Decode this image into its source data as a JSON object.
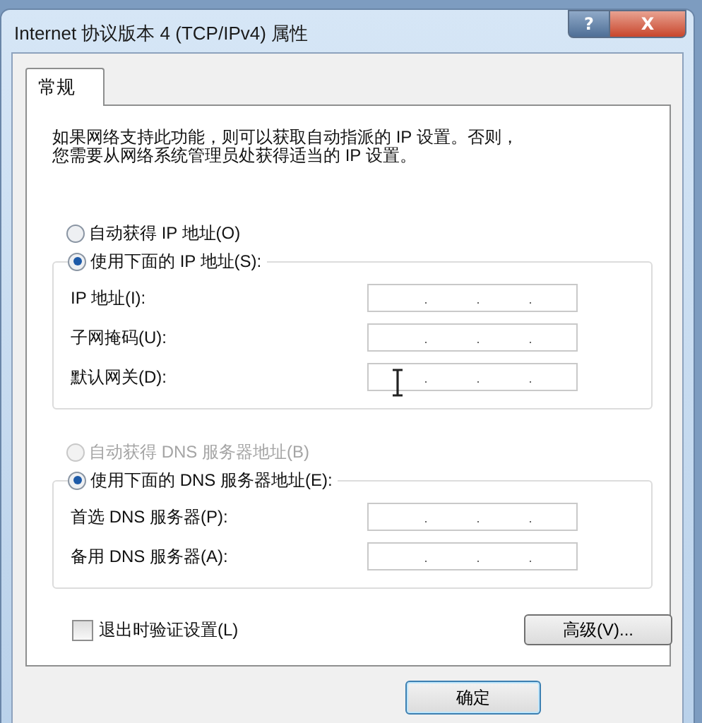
{
  "window": {
    "title": "Internet 协议版本 4 (TCP/IPv4) 属性",
    "caption_buttons": [
      {
        "kind": "help",
        "label": "?"
      },
      {
        "kind": "close",
        "label": "X"
      }
    ]
  },
  "tabs": [
    {
      "label": "常规",
      "selected": true
    }
  ],
  "description": "如果网络支持此功能，则可以获取自动指派的 IP 设置。否则，您需要从网络系统管理员处获得适当的 IP 设置。",
  "sections": [
    {
      "options": [
        {
          "label": "自动获得 IP 地址(O)",
          "selected": false,
          "disabled": false
        },
        {
          "label": "使用下面的 IP 地址(S):",
          "selected": true,
          "disabled": false
        }
      ],
      "fields": [
        {
          "label": "IP 地址(I):"
        },
        {
          "label": "子网掩码(U):"
        },
        {
          "label": "默认网关(D):"
        }
      ]
    },
    {
      "options": [
        {
          "label": "自动获得 DNS 服务器地址(B)",
          "selected": false,
          "disabled": true
        },
        {
          "label": "使用下面的 DNS 服务器地址(E):",
          "selected": true,
          "disabled": false
        }
      ],
      "fields": [
        {
          "label": "首选 DNS 服务器(P):"
        },
        {
          "label": "备用 DNS 服务器(A):"
        }
      ]
    }
  ],
  "checkbox": {
    "label": "退出时验证设置(L)",
    "checked": false
  },
  "advanced_button": "高级(V)...",
  "footer_buttons": [
    "确定"
  ]
}
